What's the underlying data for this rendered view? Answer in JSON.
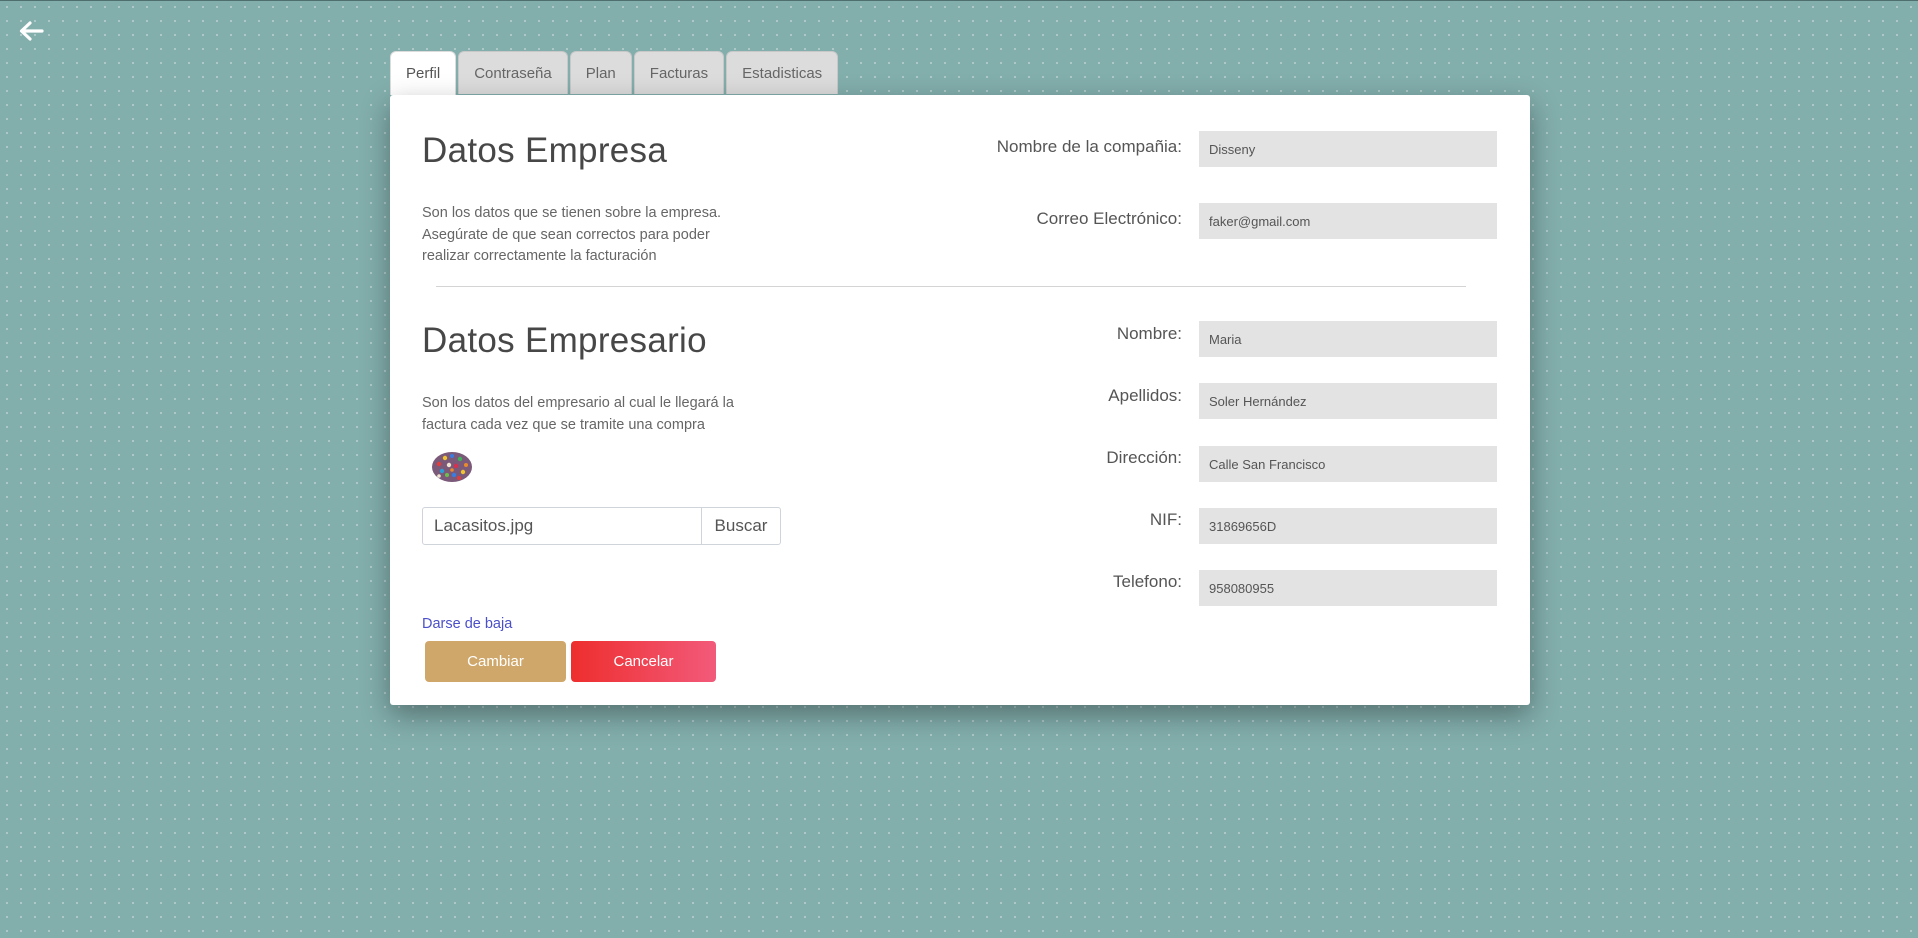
{
  "nav": {
    "back_icon": "arrow-left-icon"
  },
  "tabs": [
    {
      "label": "Perfil",
      "active": true
    },
    {
      "label": "Contraseña",
      "active": false
    },
    {
      "label": "Plan",
      "active": false
    },
    {
      "label": "Facturas",
      "active": false
    },
    {
      "label": "Estadisticas",
      "active": false
    }
  ],
  "empresa": {
    "title": "Datos Empresa",
    "description": "Son los datos que se tienen sobre la empresa. Asegúrate de que sean correctos para poder realizar correctamente la facturación",
    "fields": {
      "company_name": {
        "label": "Nombre de la compañia:",
        "value": "Disseny"
      },
      "email": {
        "label": "Correo Electrónico:",
        "value": "faker@gmail.com"
      }
    }
  },
  "empresario": {
    "title": "Datos Empresario",
    "description": "Son los datos del empresario al cual le llegará la factura cada vez que se tramite una compra",
    "fields": {
      "nombre": {
        "label": "Nombre:",
        "value": "Maria"
      },
      "apellidos": {
        "label": "Apellidos:",
        "value": "Soler Hernández"
      },
      "direccion": {
        "label": "Dirección:",
        "value": "Calle San Francisco"
      },
      "nif": {
        "label": "NIF:",
        "value": "31869656D"
      },
      "telefono": {
        "label": "Telefono:",
        "value": "958080955"
      }
    },
    "file": {
      "name": "Lacasitos.jpg",
      "browse_label": "Buscar"
    }
  },
  "actions": {
    "unsubscribe_label": "Darse de baja",
    "change_label": "Cambiar",
    "cancel_label": "Cancelar"
  },
  "colors": {
    "background": "#82aeac",
    "change_button": "#d0a76a",
    "cancel_button_start": "#ee2e2e",
    "cancel_button_end": "#f25a7a",
    "link": "#4b4fc9"
  }
}
